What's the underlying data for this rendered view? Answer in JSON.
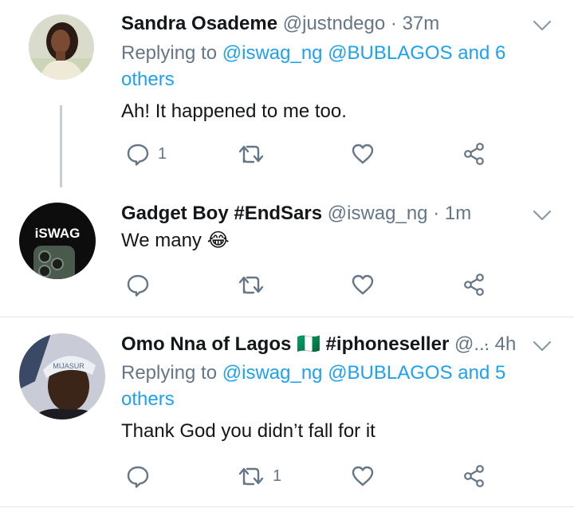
{
  "colors": {
    "link": "#1da1f2",
    "muted": "#657786",
    "text": "#14171a",
    "divider": "#e1e8ed",
    "thread": "#c4cfd6"
  },
  "tweets": [
    {
      "name": "Sandra Osademe",
      "handle": "@justndego",
      "separator": "·",
      "time": "37m",
      "reply_prefix": "Replying to",
      "reply_user1": "@iswag_ng",
      "reply_user2": "@BUBLAGOS",
      "reply_others": "and 6 others",
      "text": "Ah! It happened to me too.",
      "reply_count": "1",
      "retweet_count": "",
      "avatar_icon": "person-photo"
    },
    {
      "name": "Gadget Boy #EndSars",
      "handle": "@iswag_ng",
      "separator": "·",
      "time": "1m",
      "text": "We many",
      "emoji": "😂",
      "reply_count": "",
      "retweet_count": "",
      "avatar_text": "iSWAG",
      "avatar_icon": "phone-photo"
    },
    {
      "name": "Omo Nna of Lagos 🇳🇬 #iphoneseller",
      "handle": "@...",
      "separator": "·",
      "time": "4h",
      "reply_prefix": "Replying to",
      "reply_user1": "@iswag_ng",
      "reply_user2": "@BUBLAGOS",
      "reply_others": "and 5 others",
      "text": "Thank God you didn’t fall for it",
      "reply_count": "",
      "retweet_count": "1",
      "avatar_icon": "person-photo"
    }
  ]
}
